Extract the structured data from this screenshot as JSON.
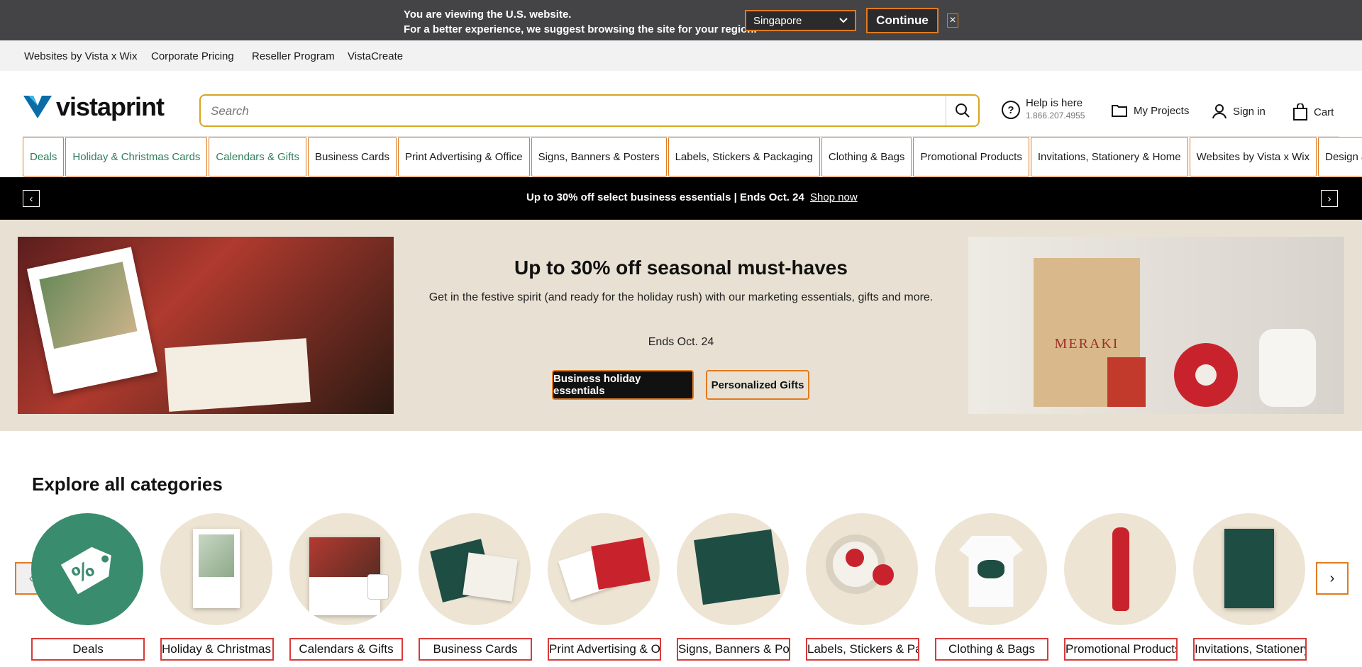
{
  "region_banner": {
    "line1": "You are viewing the U.S. website.",
    "line2": "For a better experience, we suggest browsing the site for your region.",
    "selected_region": "Singapore",
    "continue_label": "Continue",
    "close_label": "×"
  },
  "utility_links": [
    "Websites by Vista x Wix",
    "Corporate Pricing",
    "Reseller Program",
    "VistaCreate"
  ],
  "header": {
    "logo_text": "vistaprint",
    "search_placeholder": "Search",
    "help_label": "Help is here",
    "help_phone": "1.866.207.4955",
    "projects_label": "My Projects",
    "signin_label": "Sign in",
    "cart_label": "Cart"
  },
  "category_nav": [
    "Deals",
    "Holiday & Christmas Cards",
    "Calendars & Gifts",
    "Business Cards",
    "Print Advertising & Office",
    "Signs, Banners & Posters",
    "Labels, Stickers & Packaging",
    "Clothing & Bags",
    "Promotional Products",
    "Invitations, Stationery & Home",
    "Websites by Vista x Wix",
    "Design & Logo"
  ],
  "promo_strip": {
    "text": "Up to 30% off select business essentials | Ends Oct. 24",
    "link": "Shop now",
    "prev_icon": "‹",
    "next_icon": "›"
  },
  "hero": {
    "title": "Up to 30% off seasonal must-haves",
    "subtitle": "Get in the festive spirit (and ready for the holiday rush) with our marketing essentials, gifts and more.",
    "ends": "Ends Oct. 24",
    "primary_button": "Business holiday essentials",
    "secondary_button": "Personalized Gifts",
    "bag_brand": "MERAKI"
  },
  "explore": {
    "title": "Explore all categories",
    "prev_icon": "‹",
    "next_icon": "›",
    "tiles": [
      "Deals",
      "Holiday & Christmas Cards",
      "Calendars & Gifts",
      "Business Cards",
      "Print Advertising & Office",
      "Signs, Banners & Posters",
      "Labels, Stickers & Packaging",
      "Clothing & Bags",
      "Promotional Products",
      "Invitations, Stationery & Home"
    ]
  },
  "colors": {
    "banner_bg": "#444446",
    "accent_orange": "#e07b20",
    "deals_green": "#3a8c6e",
    "hero_bg": "#e8e1d3",
    "circle_bg": "#ede4d3",
    "meraki_red": "#c8232c"
  }
}
